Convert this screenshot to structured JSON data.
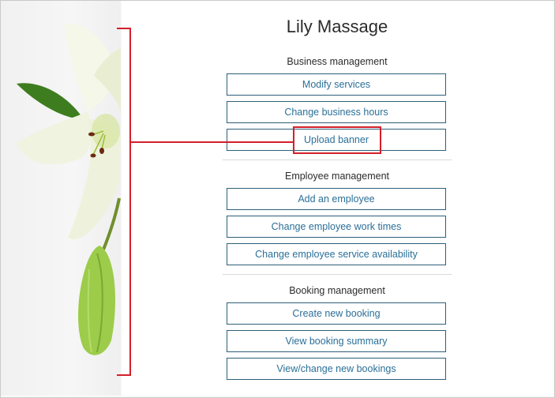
{
  "app_title": "Lily Massage",
  "sections": [
    {
      "heading": "Business management",
      "buttons": [
        "Modify services",
        "Change business hours",
        "Upload banner"
      ]
    },
    {
      "heading": "Employee management",
      "buttons": [
        "Add an employee",
        "Change employee work times",
        "Change employee service availability"
      ]
    },
    {
      "heading": "Booking management",
      "buttons": [
        "Create new booking",
        "View booking summary",
        "View/change new bookings"
      ]
    }
  ],
  "colors": {
    "accent_text": "#2a6f98",
    "button_border": "#2e5f7a",
    "annotation": "#d31f2a"
  },
  "decoration": {
    "image": "white-lily-flower"
  }
}
